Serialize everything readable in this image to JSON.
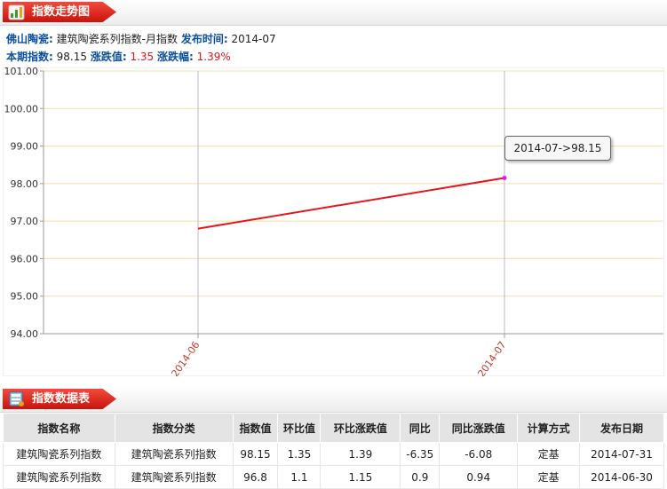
{
  "trend_section": {
    "title": "指数走势图"
  },
  "info": {
    "line1_label1": "佛山陶瓷:",
    "line1_value1": "建筑陶瓷系列指数-月指数",
    "line1_label2": "发布时间:",
    "line1_value2": "2014-07",
    "line2_label1": "本期指数:",
    "line2_value1": "98.15",
    "line2_label2": "涨跌值:",
    "line2_value2": "1.35",
    "line2_label3": "涨跌幅:",
    "line2_value3": "1.39%"
  },
  "chart_data": {
    "type": "line",
    "title": "",
    "xlabel": "",
    "ylabel": "",
    "categories": [
      "2014-06",
      "2014-07"
    ],
    "series": [
      {
        "values": [
          96.8,
          98.15
        ]
      }
    ],
    "ylim": [
      94.0,
      101.0
    ],
    "yticks": [
      "94.00",
      "95.00",
      "96.00",
      "97.00",
      "98.00",
      "99.00",
      "100.00",
      "101.00"
    ],
    "grid": true,
    "line_color": "#e8141c",
    "grid_color": "#f0e0a8",
    "tooltip": "2014-07->98.15"
  },
  "table_section": {
    "title": "指数数据表"
  },
  "table": {
    "headers": [
      "指数名称",
      "指数分类",
      "指数值",
      "环比值",
      "环比涨跌值",
      "同比",
      "同比涨跌值",
      "计算方式",
      "发布日期"
    ],
    "rows": [
      [
        "建筑陶瓷系列指数",
        "建筑陶瓷系列指数",
        "98.15",
        "1.35",
        "1.39",
        "-6.35",
        "-6.08",
        "定基",
        "2014-07-31"
      ],
      [
        "建筑陶瓷系列指数",
        "建筑陶瓷系列指数",
        "96.8",
        "1.1",
        "1.15",
        "0.9",
        "0.94",
        "定基",
        "2014-06-30"
      ]
    ]
  },
  "colors": {
    "accent_red": "#e2131d",
    "label_blue": "#0b4f9e",
    "positive": "#e2131d",
    "negative": "#1c8a1c"
  }
}
